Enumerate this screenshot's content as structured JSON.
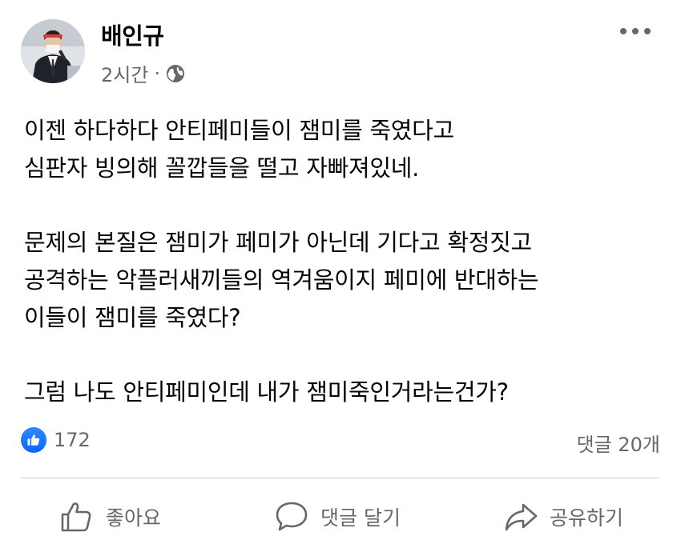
{
  "post": {
    "author": "배인규",
    "time": "2시간",
    "separator": "·",
    "privacy_icon": "globe-icon",
    "more_icon": "more-options-icon",
    "body_lines": [
      "이젠 하다하다 안티페미들이 잼미를 죽였다고",
      "심판자 빙의해 꼴깝들을 떨고 자빠져있네.",
      "",
      "문제의 본질은 잼미가 페미가 아닌데 기다고 확정짓고",
      "공격하는 악플러새끼들의 역겨움이지 페미에 반대하는",
      "이들이 잼미를 죽였다?",
      "",
      "그럼 나도 안티페미인데 내가 잼미죽인거라는건가?"
    ]
  },
  "stats": {
    "reaction_icon": "like-reaction-icon",
    "reaction_count": "172",
    "comments": "댓글 20개"
  },
  "actions": {
    "like": "좋아요",
    "comment": "댓글 달기",
    "share": "공유하기"
  },
  "colors": {
    "text": "#050505",
    "secondary_text": "#65676b",
    "like_blue": "#0866ff",
    "divider": "#ced0d4"
  }
}
